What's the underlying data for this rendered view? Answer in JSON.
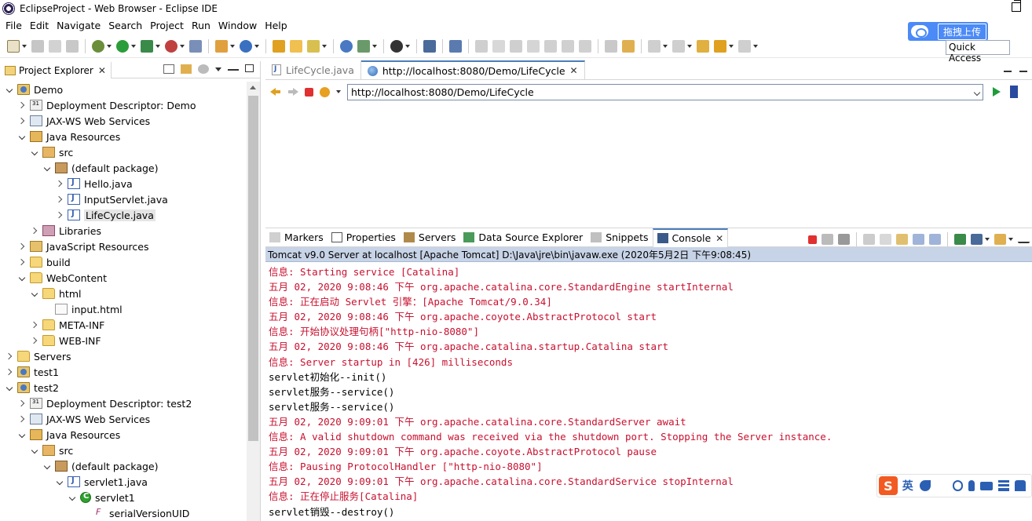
{
  "window": {
    "title": "EclipseProject - Web Browser - Eclipse IDE"
  },
  "menu": [
    "File",
    "Edit",
    "Navigate",
    "Search",
    "Project",
    "Run",
    "Window",
    "Help"
  ],
  "baidu": {
    "button_label": "拖拽上传"
  },
  "quick_access": {
    "label": "Quick Access"
  },
  "explorer": {
    "title": "Project Explorer",
    "tree": [
      {
        "label": "Demo",
        "icon": "project",
        "depth": 0,
        "arrow": "open"
      },
      {
        "label": "Deployment Descriptor: Demo",
        "icon": "descriptor",
        "depth": 1,
        "arrow": "closed"
      },
      {
        "label": "JAX-WS Web Services",
        "icon": "jaxws",
        "depth": 1,
        "arrow": "closed"
      },
      {
        "label": "Java Resources",
        "icon": "javares",
        "depth": 1,
        "arrow": "open"
      },
      {
        "label": "src",
        "icon": "src",
        "depth": 2,
        "arrow": "open"
      },
      {
        "label": "(default package)",
        "icon": "package",
        "depth": 3,
        "arrow": "open"
      },
      {
        "label": "Hello.java",
        "icon": "java",
        "depth": 4,
        "arrow": "closed"
      },
      {
        "label": "InputServlet.java",
        "icon": "java",
        "depth": 4,
        "arrow": "closed"
      },
      {
        "label": "LifeCycle.java",
        "icon": "java",
        "depth": 4,
        "arrow": "closed",
        "selected": true
      },
      {
        "label": "Libraries",
        "icon": "libraries",
        "depth": 2,
        "arrow": "closed"
      },
      {
        "label": "JavaScript Resources",
        "icon": "jsres",
        "depth": 1,
        "arrow": "closed"
      },
      {
        "label": "build",
        "icon": "folder",
        "depth": 1,
        "arrow": "closed"
      },
      {
        "label": "WebContent",
        "icon": "folder",
        "depth": 1,
        "arrow": "open"
      },
      {
        "label": "html",
        "icon": "folder",
        "depth": 2,
        "arrow": "open"
      },
      {
        "label": "input.html",
        "icon": "html",
        "depth": 3,
        "arrow": "none"
      },
      {
        "label": "META-INF",
        "icon": "folder",
        "depth": 2,
        "arrow": "closed"
      },
      {
        "label": "WEB-INF",
        "icon": "folder",
        "depth": 2,
        "arrow": "closed"
      },
      {
        "label": "Servers",
        "icon": "folder",
        "depth": 0,
        "arrow": "closed"
      },
      {
        "label": "test1",
        "icon": "project",
        "depth": 0,
        "arrow": "closed"
      },
      {
        "label": "test2",
        "icon": "project",
        "depth": 0,
        "arrow": "open"
      },
      {
        "label": "Deployment Descriptor: test2",
        "icon": "descriptor",
        "depth": 1,
        "arrow": "closed"
      },
      {
        "label": "JAX-WS Web Services",
        "icon": "jaxws",
        "depth": 1,
        "arrow": "closed"
      },
      {
        "label": "Java Resources",
        "icon": "javares",
        "depth": 1,
        "arrow": "open"
      },
      {
        "label": "src",
        "icon": "src",
        "depth": 2,
        "arrow": "open"
      },
      {
        "label": "(default package)",
        "icon": "package",
        "depth": 3,
        "arrow": "open"
      },
      {
        "label": "servlet1.java",
        "icon": "java",
        "depth": 4,
        "arrow": "open"
      },
      {
        "label": "servlet1",
        "icon": "class",
        "depth": 5,
        "arrow": "open"
      },
      {
        "label": "serialVersionUID",
        "icon": "field",
        "depth": 6,
        "arrow": "none"
      }
    ]
  },
  "editor": {
    "tabs": [
      {
        "label": "LifeCycle.java",
        "active": false
      },
      {
        "label": "http://localhost:8080/Demo/LifeCycle",
        "active": true
      }
    ],
    "url": "http://localhost:8080/Demo/LifeCycle"
  },
  "console": {
    "tabs": [
      {
        "label": "Markers",
        "active": false
      },
      {
        "label": "Properties",
        "active": false
      },
      {
        "label": "Servers",
        "active": false
      },
      {
        "label": "Data Source Explorer",
        "active": false
      },
      {
        "label": "Snippets",
        "active": false
      },
      {
        "label": "Console",
        "active": true
      }
    ],
    "status": "Tomcat v9.0 Server at localhost [Apache Tomcat] D:\\Java\\jre\\bin\\javaw.exe (2020年5月2日 下午9:08:45)",
    "lines": [
      {
        "text": "信息: Starting service [Catalina]",
        "type": "err"
      },
      {
        "text": "五月 02, 2020 9:08:46 下午 org.apache.catalina.core.StandardEngine startInternal",
        "type": "err"
      },
      {
        "text": "信息: 正在启动 Servlet 引擎：[Apache Tomcat/9.0.34]",
        "type": "err"
      },
      {
        "text": "五月 02, 2020 9:08:46 下午 org.apache.coyote.AbstractProtocol start",
        "type": "err"
      },
      {
        "text": "信息: 开始协议处理句柄[\"http-nio-8080\"]",
        "type": "err"
      },
      {
        "text": "五月 02, 2020 9:08:46 下午 org.apache.catalina.startup.Catalina start",
        "type": "err"
      },
      {
        "text": "信息: Server startup in [426] milliseconds",
        "type": "err"
      },
      {
        "text": "servlet初始化--init()",
        "type": "out"
      },
      {
        "text": "servlet服务--service()",
        "type": "out"
      },
      {
        "text": "servlet服务--service()",
        "type": "out"
      },
      {
        "text": "五月 02, 2020 9:09:01 下午 org.apache.catalina.core.StandardServer await",
        "type": "err"
      },
      {
        "text": "信息: A valid shutdown command was received via the shutdown port. Stopping the Server instance.",
        "type": "err"
      },
      {
        "text": "五月 02, 2020 9:09:01 下午 org.apache.coyote.AbstractProtocol pause",
        "type": "err"
      },
      {
        "text": "信息: Pausing ProtocolHandler [\"http-nio-8080\"]",
        "type": "err"
      },
      {
        "text": "五月 02, 2020 9:09:01 下午 org.apache.catalina.core.StandardService stopInternal",
        "type": "err"
      },
      {
        "text": "信息: 正在停止服务[Catalina]",
        "type": "err"
      },
      {
        "text": "servlet销毁--destroy()",
        "type": "out"
      }
    ]
  },
  "ime": {
    "logo": "S",
    "lang": "英"
  },
  "colors": {
    "error_text": "#c8102e",
    "accent": "#4a7ebb",
    "status_bg": "#c7d3e6"
  }
}
